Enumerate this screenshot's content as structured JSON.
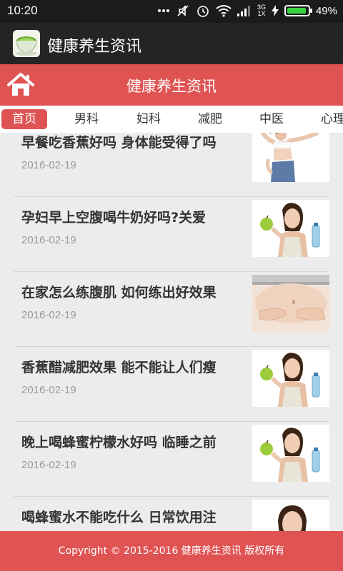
{
  "status_bar": {
    "time": "10:20",
    "network": "3G\n1X",
    "battery_percent": "49%",
    "battery_level": 0.49
  },
  "app_bar": {
    "title": "健康养生资讯",
    "icon": "green-tea-cup-icon"
  },
  "header": {
    "title": "健康养生资讯",
    "home_icon": "home-icon"
  },
  "tabs": [
    {
      "label": "首页",
      "active": true
    },
    {
      "label": "男科",
      "active": false
    },
    {
      "label": "妇科",
      "active": false
    },
    {
      "label": "减肥",
      "active": false
    },
    {
      "label": "中医",
      "active": false
    },
    {
      "label": "心理",
      "active": false
    }
  ],
  "articles": [
    {
      "title": "早餐吃香蕉好吗 身体能受得了吗",
      "date": "2016-02-19",
      "thumb": "woman-waist-photo"
    },
    {
      "title": "孕妇早上空腹喝牛奶好吗?关爱",
      "date": "2016-02-19",
      "thumb": "woman-apple-photo"
    },
    {
      "title": "在家怎么练腹肌 如何练出好效果",
      "date": "2016-02-19",
      "thumb": "belly-photo"
    },
    {
      "title": "香蕉醋减肥效果 能不能让人们瘦",
      "date": "2016-02-19",
      "thumb": "woman-apple-photo"
    },
    {
      "title": "晚上喝蜂蜜柠檬水好吗 临睡之前",
      "date": "2016-02-19",
      "thumb": "woman-apple-photo"
    },
    {
      "title": "喝蜂蜜水不能吃什么 日常饮用注",
      "date": "",
      "thumb": "woman-face-photo"
    }
  ],
  "footer": {
    "text": "Copyright © 2015-2016 健康养生资讯 版权所有"
  },
  "colors": {
    "accent": "#e05353",
    "app_bar": "#242424",
    "status_bar": "#1b1b1b",
    "list_bg": "#ececec"
  }
}
